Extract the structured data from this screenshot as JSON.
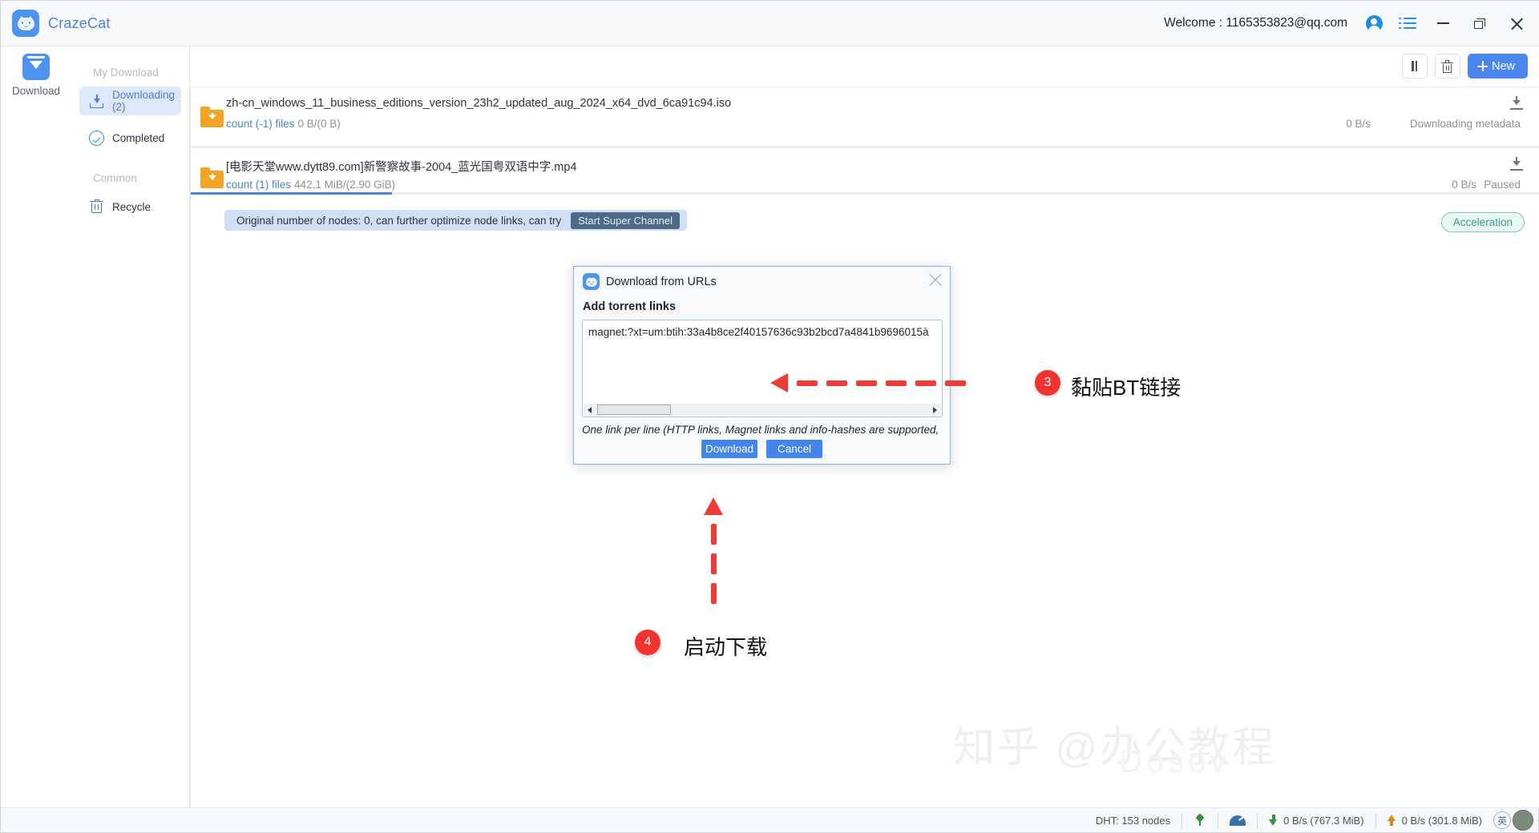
{
  "titlebar": {
    "brand": "CrazeCat",
    "welcome": "Welcome : 1165353823@qq.com",
    "icons": {
      "account": "account-icon",
      "menu": "list-menu-icon"
    },
    "window_controls": {
      "minimize": "minimize-icon",
      "maximize": "maximize-icon",
      "close": "close-icon"
    }
  },
  "rail": {
    "download_label": "Download"
  },
  "sidebar": {
    "group_my_download": "My Download",
    "group_common": "Common",
    "items": [
      {
        "label": "Downloading (2)",
        "icon": "download-tray-icon",
        "active": true
      },
      {
        "label": "Completed",
        "icon": "check-circle-icon",
        "active": false
      },
      {
        "label": "Recycle",
        "icon": "trash-icon",
        "active": false
      }
    ]
  },
  "toolbar": {
    "pause_label": "pause-icon",
    "delete_label": "trash-icon",
    "new_label": "New"
  },
  "tasks": [
    {
      "name": "zh-cn_windows_11_business_editions_version_23h2_updated_aug_2024_x64_dvd_6ca91c94.iso",
      "count": "count (-1) files",
      "size": "0 B/(0 B)",
      "speed": "0 B/s",
      "status": "Downloading metadata",
      "progress": 0
    },
    {
      "name": "[电影天堂www.dytt89.com]新警察故事-2004_蓝光国粤双语中字.mp4",
      "count": "count (1) files",
      "size": "442.1 MiB/(2.90 GiB)",
      "speed": "0 B/s",
      "status": "Paused",
      "progress": 14.9
    }
  ],
  "notice": {
    "text": "Original number of nodes: 0, can further optimize node links, can try",
    "button": "Start Super Channel",
    "accel_button": "Acceleration"
  },
  "dialog": {
    "title": "Download from URLs",
    "label": "Add torrent links",
    "link_value": "magnet:?xt=um:btih:33a4b8ce2f40157636c93b2bcd7a4841b9696015à",
    "hint": "One link per line (HTTP links, Magnet links and info-hashes are supported,",
    "download_button": "Download",
    "cancel_button": "Cancel",
    "close_icon": "close-icon"
  },
  "annotations": [
    {
      "number": "3",
      "text": "黏贴BT链接"
    },
    {
      "number": "4",
      "text": "启动下载"
    }
  ],
  "watermark": {
    "line1": "知乎 @办公教程",
    "line2": "Dosov"
  },
  "statusbar": {
    "dht": "DHT: 153 nodes",
    "plug_icon": "plug-icon",
    "gauge_icon": "speed-gauge-icon",
    "download_speed": "0 B/s (767.3 MiB)",
    "upload_speed": "0 B/s (301.8 MiB)",
    "ime": "英"
  },
  "colors": {
    "accent": "#4a86ee",
    "brand": "#4f80e8",
    "folder": "#f4a425",
    "notice_bg": "#cfe0f5",
    "annotation_red": "#ee3b36",
    "accel": "#3c9a85"
  }
}
